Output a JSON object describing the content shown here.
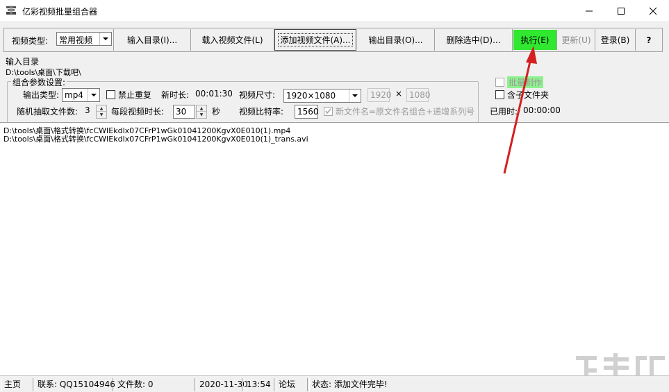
{
  "window": {
    "title": "亿彩视频批量组合器",
    "controls": {
      "minimize": "—",
      "maximize": "☐",
      "close": "✕"
    }
  },
  "toolbar": {
    "video_type_label": "视频类型:",
    "video_type_value": "常用视频",
    "input_dir_label": "输入目录(I)...",
    "load_video_label": "载入视频文件(L)",
    "add_video_label": "添加视频文件(A)...",
    "output_dir_label": "输出目录(O)...",
    "delete_selected_label": "删除选中(D)...",
    "execute_label": "执行(E)",
    "update_label": "更新(U)",
    "login_label": "登录(B)",
    "help_label": "?",
    "execute_color": "#2fe82f"
  },
  "input_dir": {
    "label": "输入目录",
    "path": "D:\\tools\\桌面\\下载吧\\"
  },
  "params": {
    "group_title": "组合参数设置:",
    "output_type_label": "输出类型:",
    "output_type_value": "mp4",
    "no_repeat_label": "禁止重复",
    "new_duration_label": "新时长:",
    "new_duration_value": "00:01:30",
    "video_size_label": "视频尺寸:",
    "video_size_value": "1920×1080",
    "width_value": "1920",
    "times_sign": "×",
    "height_value": "1080",
    "random_count_label": "随机抽取文件数:",
    "random_count_value": "3",
    "segment_duration_label": "每段视频时长:",
    "segment_duration_value": "30",
    "seconds_unit": "秒",
    "bitrate_label": "视频比特率:",
    "bitrate_value": "1560",
    "filename_rule_label": "新文件名=原文件名组合+递增系列号"
  },
  "right_options": {
    "batch_label": "批量制作",
    "subfolder_label": "含子文件夹",
    "elapsed_label": "已用时:",
    "elapsed_value": "00:00:00"
  },
  "file_list": [
    "D:\\tools\\桌面\\格式转换\\fcCWIEkdlx07CFrP1wGk01041200KgvX0E010(1).mp4",
    "D:\\tools\\桌面\\格式转换\\fcCWIEkdlx07CFrP1wGk01041200KgvX0E010(1)_trans.avi"
  ],
  "status_bar": {
    "home": "主页",
    "contact": "联系:  QQ15104946",
    "file_count": "文件数:  0",
    "date": "2020-11-30",
    "time": "13:54",
    "forum": "论坛",
    "status": "状态:  添加文件完毕!"
  },
  "watermark": "下载吧"
}
